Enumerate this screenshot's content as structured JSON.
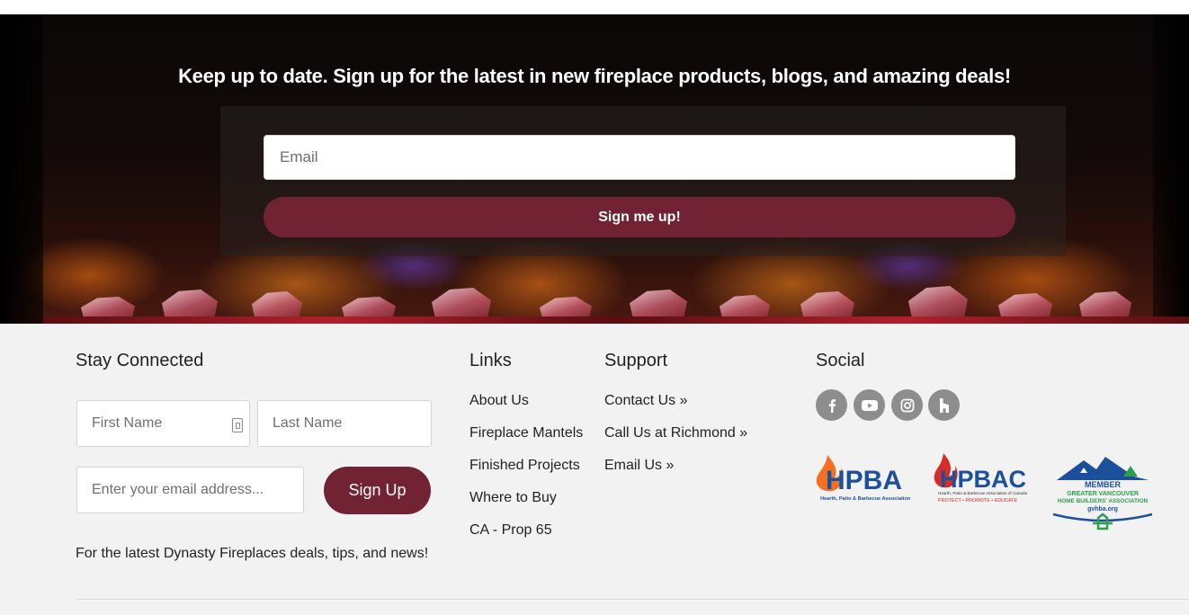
{
  "newsletter": {
    "title": "Keep up to date. Sign up for the latest in new fireplace products, blogs, and amazing deals!",
    "email_placeholder": "Email",
    "button_label": "Sign me up!"
  },
  "stay_connected": {
    "heading": "Stay Connected",
    "first_name_placeholder": "First Name",
    "last_name_placeholder": "Last Name",
    "email_placeholder": "Enter your email address...",
    "button_label": "Sign Up",
    "tagline": "For the latest Dynasty Fireplaces deals, tips, and news!"
  },
  "links": {
    "heading": "Links",
    "items": [
      {
        "label": "About Us"
      },
      {
        "label": "Fireplace Mantels"
      },
      {
        "label": "Finished Projects"
      },
      {
        "label": "Where to Buy"
      },
      {
        "label": "CA - Prop 65"
      }
    ]
  },
  "support": {
    "heading": "Support",
    "items": [
      {
        "label": "Contact Us »"
      },
      {
        "label": "Call Us at Richmond »"
      },
      {
        "label": "Email Us »"
      }
    ]
  },
  "social": {
    "heading": "Social",
    "icons": [
      "facebook-icon",
      "youtube-icon",
      "instagram-icon",
      "houzz-icon"
    ]
  },
  "badges": {
    "hpba": {
      "name": "HPBA",
      "subtitle": "Hearth, Patio & Barbecue Association"
    },
    "hpbac": {
      "name": "HPBAC",
      "subtitle": "Hearth, Patio & Barbecue Association of Canada",
      "motto": "PROTECT • PROMOTE • EDUCATE"
    },
    "gvhba": {
      "member": "MEMBER",
      "line1": "GREATER VANCOUVER",
      "line2": "HOME BUILDERS' ASSOCIATION",
      "site": "gvhba.org"
    }
  },
  "colors": {
    "accent": "#722333",
    "footer_bg": "#f2f2f2",
    "social_icon_bg": "#8d8d8d",
    "hpba_orange": "#f37021",
    "hpba_blue": "#1c4f9c",
    "hpbac_red": "#d62d26"
  }
}
